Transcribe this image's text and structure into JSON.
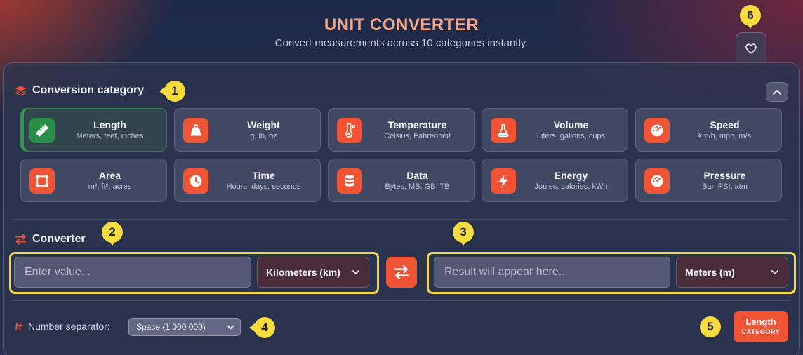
{
  "header": {
    "title": "UNIT CONVERTER",
    "subtitle": "Convert measurements across 10 categories instantly.",
    "favorite_icon": "heart-icon"
  },
  "categories_section": {
    "title": "Conversion category",
    "icon": "layers-icon",
    "collapse_icon": "chevron-up-icon",
    "active": "Length",
    "items": [
      {
        "name": "Length",
        "desc": "Meters, feet, inches",
        "icon": "ruler-icon"
      },
      {
        "name": "Weight",
        "desc": "g, lb, oz",
        "icon": "weight-icon"
      },
      {
        "name": "Temperature",
        "desc": "Celsius, Fahrenheit",
        "icon": "thermometer-icon"
      },
      {
        "name": "Volume",
        "desc": "Liters, gallons, cups",
        "icon": "flask-icon"
      },
      {
        "name": "Speed",
        "desc": "km/h, mph, m/s",
        "icon": "gauge-icon"
      },
      {
        "name": "Area",
        "desc": "m², ft², acres",
        "icon": "area-icon"
      },
      {
        "name": "Time",
        "desc": "Hours, days, seconds",
        "icon": "clock-icon"
      },
      {
        "name": "Data",
        "desc": "Bytes, MB, GB, TB",
        "icon": "database-icon"
      },
      {
        "name": "Energy",
        "desc": "Joules, calories, kWh",
        "icon": "bolt-icon"
      },
      {
        "name": "Pressure",
        "desc": "Bar, PSI, atm",
        "icon": "gauge-icon"
      }
    ]
  },
  "converter": {
    "title": "Converter",
    "icon": "swap-arrows-icon",
    "input_placeholder": "Enter value...",
    "from_unit": "Kilometers (km)",
    "result_placeholder": "Result will appear here...",
    "to_unit": "Meters (m)",
    "swap_icon": "swap-arrows-icon"
  },
  "separator": {
    "label": "Number separator:",
    "icon": "hash-icon",
    "selected": "Space (1 000 000)"
  },
  "category_badge": {
    "name": "Length",
    "caption": "CATEGORY"
  },
  "markers": [
    "1",
    "2",
    "3",
    "4",
    "5",
    "6"
  ],
  "colors": {
    "accent": "#f05434",
    "active_green": "#2a8f46",
    "highlight": "#f4d73c",
    "title": "#f4a58a"
  }
}
